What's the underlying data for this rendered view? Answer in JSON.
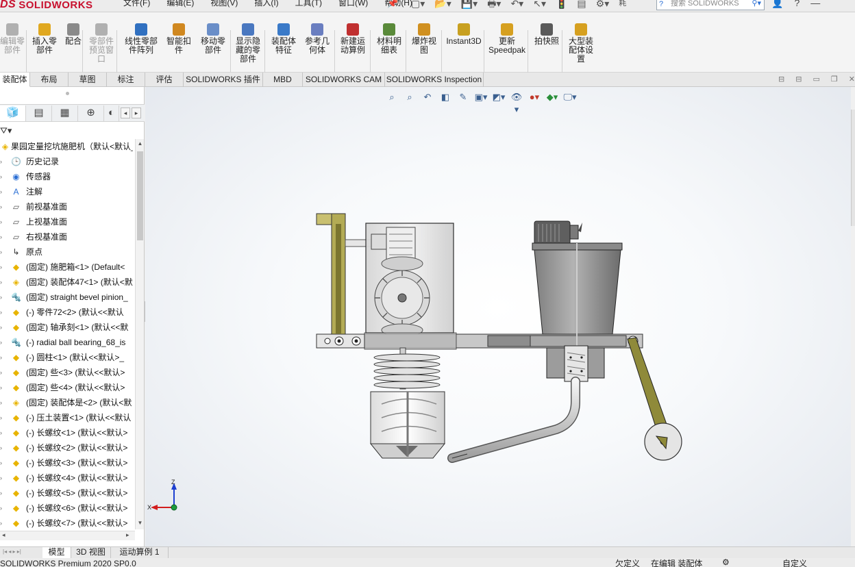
{
  "app": {
    "logo_prefix": "DS",
    "logo_text": "SOLIDWORKS",
    "menus": [
      "文件(F)",
      "编辑(E)",
      "视图(V)",
      "插入(I)",
      "工具(T)",
      "窗口(W)",
      "帮助(H)"
    ],
    "search_placeholder": "搜索 SOLIDWORKS",
    "help_label": "?",
    "quick_extra": "耗"
  },
  "command_manager": {
    "buttons": [
      {
        "label": "编辑零\n部件",
        "dim": true
      },
      {
        "label": "插入零\n部件"
      },
      {
        "label": "配合"
      },
      {
        "label": "零部件\n预览窗\n口",
        "dim": true
      },
      {
        "label": "线性零部\n件阵列"
      },
      {
        "label": "智能扣\n件"
      },
      {
        "label": "移动零\n部件"
      },
      {
        "label": "显示隐\n藏的零\n部件"
      },
      {
        "label": "装配体\n特征"
      },
      {
        "label": "参考几\n何体"
      },
      {
        "label": "新建运\n动算例"
      },
      {
        "label": "材料明\n细表"
      },
      {
        "label": "爆炸视\n图"
      },
      {
        "label": "Instant3D"
      },
      {
        "label": "更新\nSpeedpak"
      },
      {
        "label": "拍快照"
      },
      {
        "label": "大型装\n配体设\n置"
      }
    ]
  },
  "tabs": [
    "装配体",
    "布局",
    "草图",
    "标注",
    "评估",
    "SOLIDWORKS 插件",
    "MBD",
    "SOLIDWORKS CAM",
    "SOLIDWORKS Inspection"
  ],
  "tree": {
    "root": "果园定量挖坑施肥机（默认<默认_",
    "items": [
      {
        "label": "历史记录",
        "icon": "history"
      },
      {
        "label": "传感器",
        "icon": "sensor"
      },
      {
        "label": "注解",
        "icon": "annotation"
      },
      {
        "label": "前视基准面",
        "icon": "plane"
      },
      {
        "label": "上视基准面",
        "icon": "plane"
      },
      {
        "label": "右视基准面",
        "icon": "plane"
      },
      {
        "label": "原点",
        "icon": "origin"
      },
      {
        "label": "(固定) 施肥箱<1> (Default<",
        "icon": "part"
      },
      {
        "label": "(固定) 装配体47<1> (默认<默",
        "icon": "assembly"
      },
      {
        "label": "(固定) straight bevel pinion_",
        "icon": "toolbox"
      },
      {
        "label": "(-) 零件72<2> (默认<<默认",
        "icon": "part"
      },
      {
        "label": "(固定) 轴承刻<1> (默认<<默",
        "icon": "part"
      },
      {
        "label": "(-) radial ball bearing_68_is",
        "icon": "toolbox"
      },
      {
        "label": "(-) 圆柱<1> (默认<<默认>_",
        "icon": "part"
      },
      {
        "label": "(固定) 些<3> (默认<<默认>",
        "icon": "part"
      },
      {
        "label": "(固定) 些<4> (默认<<默认>",
        "icon": "part"
      },
      {
        "label": "(固定) 装配体是<2> (默认<默",
        "icon": "assembly"
      },
      {
        "label": "(-) 压土装置<1> (默认<<默认",
        "icon": "part"
      },
      {
        "label": "(-) 长螺纹<1> (默认<<默认>",
        "icon": "part"
      },
      {
        "label": "(-) 长螺纹<2> (默认<<默认>",
        "icon": "part"
      },
      {
        "label": "(-) 长螺纹<3> (默认<<默认>",
        "icon": "part"
      },
      {
        "label": "(-) 长螺纹<4> (默认<<默认>",
        "icon": "part"
      },
      {
        "label": "(-) 长螺纹<5> (默认<<默认>",
        "icon": "part"
      },
      {
        "label": "(-) 长螺纹<6> (默认<<默认>",
        "icon": "part"
      },
      {
        "label": "(-) 长螺纹<7> (默认<<默认>",
        "icon": "part"
      }
    ]
  },
  "triad": {
    "z": "Z",
    "x": "X"
  },
  "bottom_tabs": [
    "模型",
    "3D 视图",
    "运动算例 1"
  ],
  "status": {
    "left": "SOLIDWORKS Premium 2020 SP0.0",
    "under_defined": "欠定义",
    "editing": "在编辑 装配体",
    "custom": "自定义"
  },
  "colors": {
    "accent": "#2b6fd4",
    "logo_red": "#c8102e",
    "part_yellow": "#e8b400",
    "frame_olive": "#8f8a3a"
  }
}
